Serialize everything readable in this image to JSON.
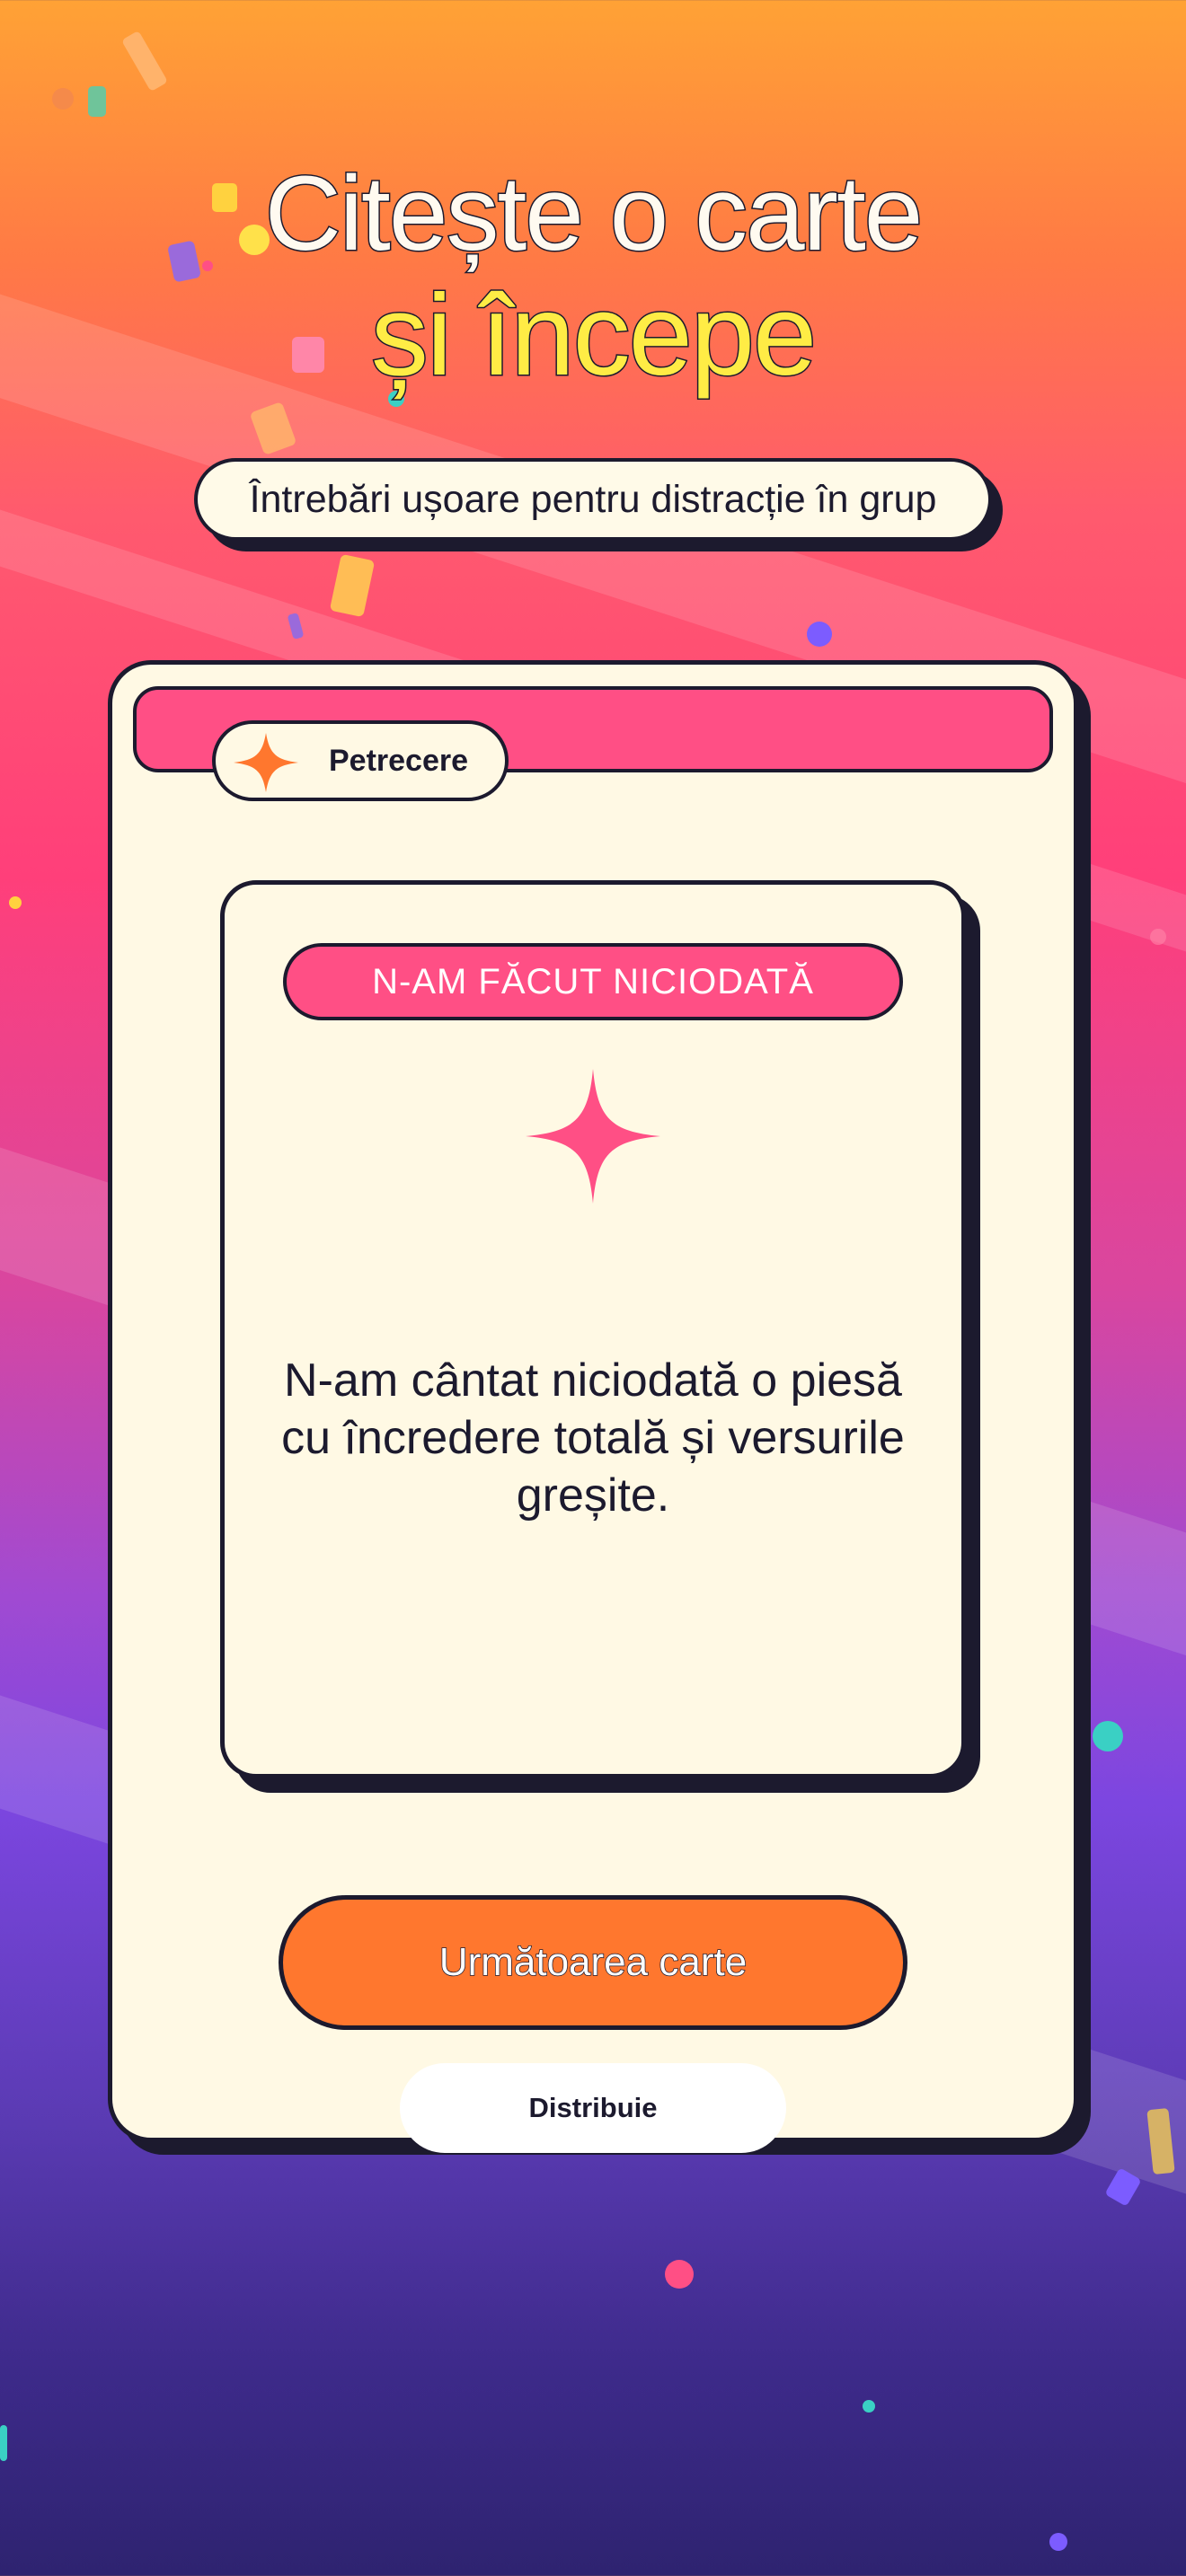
{
  "header": {
    "title_line1": "Citește o carte",
    "title_line2": "și începe",
    "subtitle": "Întrebări ușoare pentru distracție în grup"
  },
  "category": {
    "label": "Petrecere",
    "icon": "four-point-star-icon"
  },
  "card": {
    "tag": "N-AM FĂCUT NICIODATĂ",
    "icon": "sparkle-icon",
    "statement": "N-am cântat niciodată o piesă cu încredere totală și versurile greșite."
  },
  "actions": {
    "next_label": "Următoarea carte",
    "share_label": "Distribuie"
  },
  "colors": {
    "accent_pink": "#ff4f85",
    "accent_orange": "#ff772e",
    "title_yellow": "#ffec45",
    "card_cream": "#fff9e4",
    "outline": "#1c1a2e"
  }
}
